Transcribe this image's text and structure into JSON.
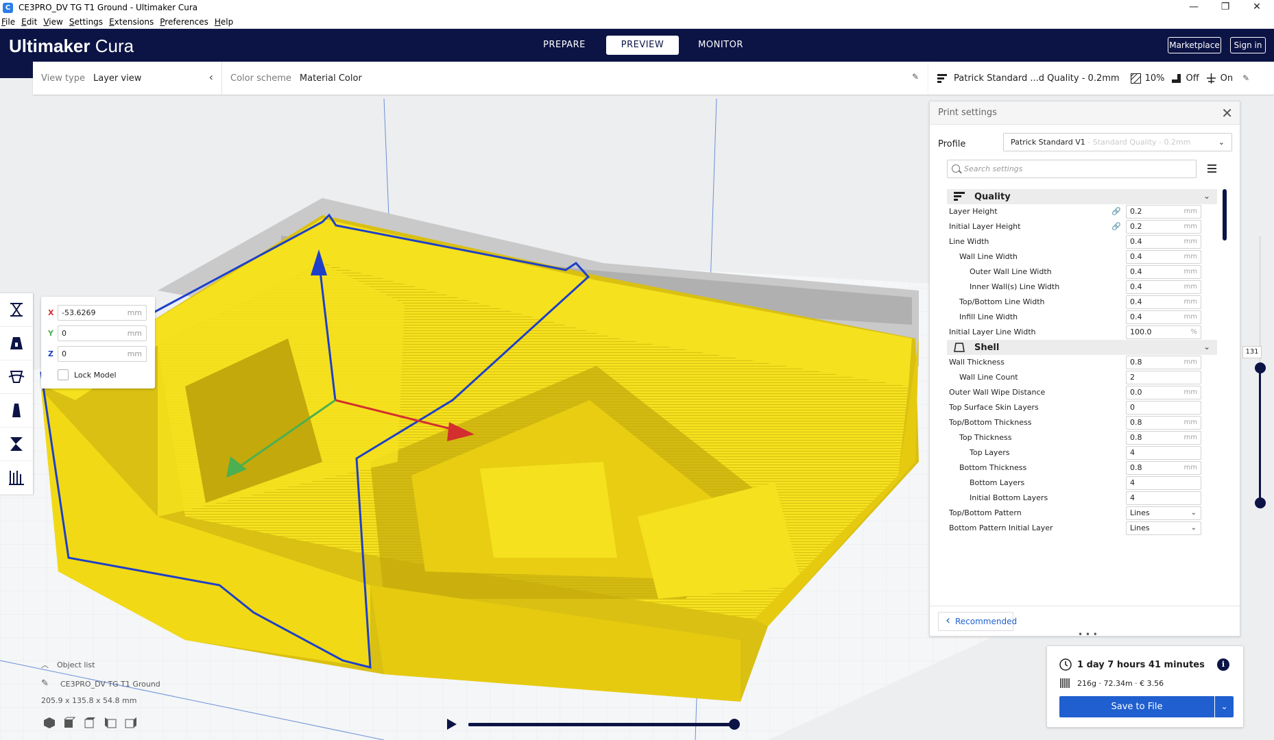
{
  "window": {
    "title": "CE3PRO_DV TG T1 Ground - Ultimaker Cura",
    "app_icon": "C",
    "minimize": "—",
    "maximize": "❐",
    "close": "✕"
  },
  "menu": [
    "File",
    "Edit",
    "View",
    "Settings",
    "Extensions",
    "Preferences",
    "Help"
  ],
  "header": {
    "logo_bold": "Ultimaker",
    "logo_light": " Cura",
    "tabs": [
      {
        "label": "PREPARE",
        "active": false
      },
      {
        "label": "PREVIEW",
        "active": true
      },
      {
        "label": "MONITOR",
        "active": false
      }
    ],
    "marketplace": "Marketplace",
    "sign_in": "Sign in"
  },
  "toolbar": {
    "view_type_label": "View type",
    "view_type_value": "Layer view",
    "color_scheme_label": "Color scheme",
    "color_scheme_value": "Material Color"
  },
  "settings_summary": {
    "profile": "Patrick Standard ...d Quality - 0.2mm",
    "infill": "10%",
    "support": "Off",
    "adhesion": "On"
  },
  "move_panel": {
    "x_label": "X",
    "x_value": "-53.6269",
    "y_label": "Y",
    "y_value": "0",
    "z_label": "Z",
    "z_value": "0",
    "unit": "mm",
    "lock_label": "Lock Model",
    "x_color": "#d32f2f",
    "y_color": "#4caf50",
    "z_color": "#1e40c8"
  },
  "print_settings": {
    "title": "Print settings",
    "profile_label": "Profile",
    "profile_value": "Patrick Standard V1",
    "profile_dim": " - Standard Quality - 0.2mm",
    "search_placeholder": "Search settings",
    "categories": {
      "quality": "Quality",
      "shell": "Shell"
    },
    "rows": [
      {
        "label": "Layer Height",
        "value": "0.2",
        "unit": "mm",
        "link": true
      },
      {
        "label": "Initial Layer Height",
        "value": "0.2",
        "unit": "mm",
        "link": true
      },
      {
        "label": "Line Width",
        "value": "0.4",
        "unit": "mm"
      },
      {
        "label": "Wall Line Width",
        "value": "0.4",
        "unit": "mm"
      },
      {
        "label": "Outer Wall Line Width",
        "value": "0.4",
        "unit": "mm"
      },
      {
        "label": "Inner Wall(s) Line Width",
        "value": "0.4",
        "unit": "mm"
      },
      {
        "label": "Top/Bottom Line Width",
        "value": "0.4",
        "unit": "mm"
      },
      {
        "label": "Infill Line Width",
        "value": "0.4",
        "unit": "mm"
      },
      {
        "label": "Initial Layer Line Width",
        "value": "100.0",
        "unit": "%"
      },
      {
        "label": "Wall Thickness",
        "value": "0.8",
        "unit": "mm"
      },
      {
        "label": "Wall Line Count",
        "value": "2",
        "unit": ""
      },
      {
        "label": "Outer Wall Wipe Distance",
        "value": "0.0",
        "unit": "mm"
      },
      {
        "label": "Top Surface Skin Layers",
        "value": "0",
        "unit": ""
      },
      {
        "label": "Top/Bottom Thickness",
        "value": "0.8",
        "unit": "mm"
      },
      {
        "label": "Top Thickness",
        "value": "0.8",
        "unit": "mm"
      },
      {
        "label": "Top Layers",
        "value": "4",
        "unit": ""
      },
      {
        "label": "Bottom Thickness",
        "value": "0.8",
        "unit": "mm"
      },
      {
        "label": "Bottom Layers",
        "value": "4",
        "unit": ""
      },
      {
        "label": "Initial Bottom Layers",
        "value": "4",
        "unit": ""
      },
      {
        "label": "Top/Bottom Pattern",
        "value": "Lines",
        "unit": ""
      },
      {
        "label": "Bottom Pattern Initial Layer",
        "value": "Lines",
        "unit": ""
      }
    ],
    "recommended": "Recommended"
  },
  "layer_slider": {
    "current": "131"
  },
  "object_list": {
    "header": "Object list",
    "name": "CE3PRO_DV TG T1 Ground",
    "dimensions": "205.9 x 135.8 x 54.8 mm"
  },
  "estimate": {
    "time": "1 day 7 hours 41 minutes",
    "material": "216g · 72.34m · € 3.56",
    "save": "Save to File",
    "info": "i"
  },
  "colors": {
    "header": "#0c1445",
    "accent": "#1f5fcf",
    "model_yellow": "#f5e11e",
    "model_shadow": "#c4a90c"
  }
}
